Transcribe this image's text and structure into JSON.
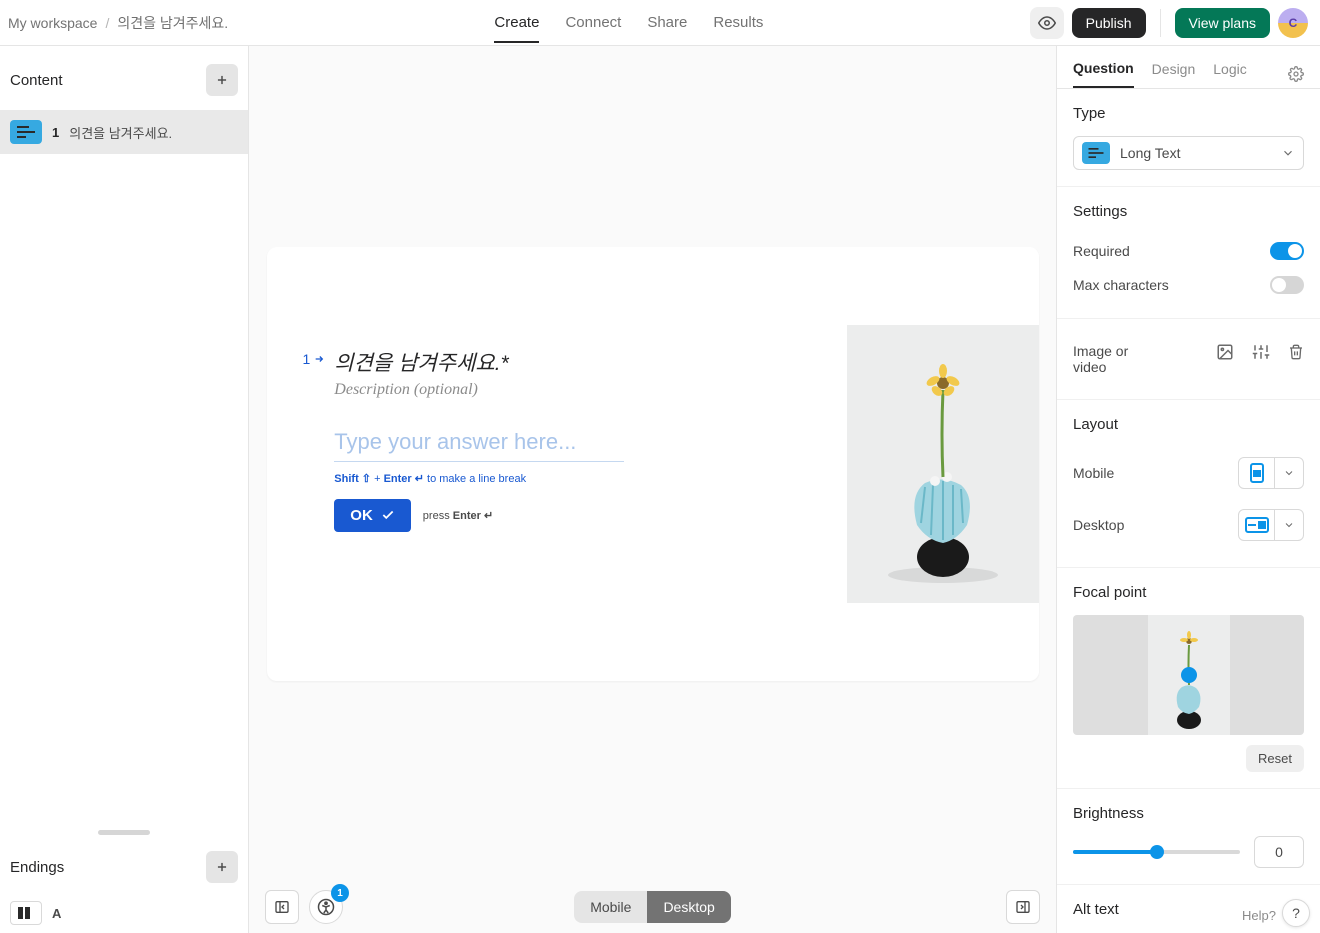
{
  "breadcrumb": {
    "workspace": "My workspace",
    "sep": "/",
    "title": "의견을 남겨주세요."
  },
  "topnav": {
    "create": "Create",
    "connect": "Connect",
    "share": "Share",
    "results": "Results"
  },
  "topbtns": {
    "publish": "Publish",
    "viewplans": "View plans",
    "avatar": "C"
  },
  "left": {
    "content_header": "Content",
    "q1_num": "1",
    "q1_title": "의견을 남겨주세요.",
    "endings_header": "Endings",
    "ending_letter": "A"
  },
  "canvas": {
    "q_index": "1",
    "q_text": "의견을 남겨주세요.",
    "q_required_mark": "*",
    "q_desc": "Description (optional)",
    "answer_placeholder": "Type your answer here...",
    "hint_shift": "Shift ⇧",
    "hint_plus": " + ",
    "hint_enter": "Enter ↵",
    "hint_rest": " to make a line break",
    "ok": "OK",
    "press": "press ",
    "press_enter": "Enter ↵"
  },
  "bottombar": {
    "mobile": "Mobile",
    "desktop": "Desktop",
    "a11y_count": "1"
  },
  "right": {
    "tabs": {
      "question": "Question",
      "design": "Design",
      "logic": "Logic"
    },
    "type_label": "Type",
    "type_value": "Long Text",
    "settings_label": "Settings",
    "required": "Required",
    "maxchars": "Max characters",
    "iv_label": "Image or video",
    "layout_label": "Layout",
    "layout_mobile": "Mobile",
    "layout_desktop": "Desktop",
    "focal_label": "Focal point",
    "reset": "Reset",
    "brightness_label": "Brightness",
    "brightness_value": "0",
    "alttext_label": "Alt text",
    "help": "Help?"
  }
}
